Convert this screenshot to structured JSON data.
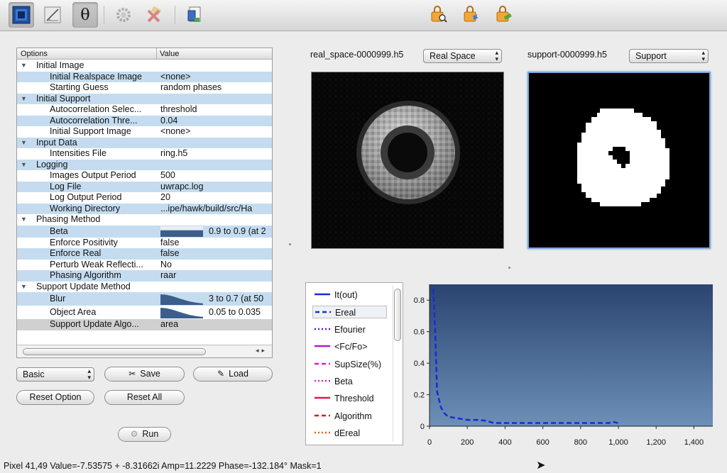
{
  "toolbar": {
    "buttons": [
      {
        "icon": "image-view-icon"
      },
      {
        "icon": "options-edit-icon"
      },
      {
        "icon": "theta-icon",
        "text": "θ"
      },
      {
        "icon": "gear-icon"
      },
      {
        "icon": "tools-disabled-icon"
      },
      {
        "icon": "document-icon"
      },
      {
        "icon": "lock-search-icon"
      },
      {
        "icon": "lock-share-icon"
      },
      {
        "icon": "lock-tools-icon"
      }
    ]
  },
  "options": {
    "col_options": "Options",
    "col_value": "Value",
    "rows": [
      {
        "type": "group",
        "label": "Initial Image"
      },
      {
        "type": "item",
        "label": "Initial Realspace Image",
        "value": "<none>"
      },
      {
        "type": "item",
        "label": "Starting Guess",
        "value": "random phases"
      },
      {
        "type": "group",
        "label": "Initial Support"
      },
      {
        "type": "item",
        "label": "Autocorrelation Selec...",
        "value": "threshold"
      },
      {
        "type": "item",
        "label": "Autocorrelation Thre...",
        "value": "0.04"
      },
      {
        "type": "item",
        "label": "Initial Support Image",
        "value": "<none>"
      },
      {
        "type": "group",
        "label": "Input Data"
      },
      {
        "type": "item",
        "label": "Intensities File",
        "value": "ring.h5"
      },
      {
        "type": "group",
        "label": "Logging"
      },
      {
        "type": "item",
        "label": "Images Output Period",
        "value": "500"
      },
      {
        "type": "item",
        "label": "Log File",
        "value": "uwrapc.log"
      },
      {
        "type": "item",
        "label": "Log Output Period",
        "value": "20"
      },
      {
        "type": "item",
        "label": "Working Directory",
        "value": "...ipe/hawk/build/src/Ha"
      },
      {
        "type": "group",
        "label": "Phasing Method"
      },
      {
        "type": "bar",
        "label": "Beta",
        "value": "0.9 to 0.9 (at 2"
      },
      {
        "type": "item",
        "label": "Enforce Positivity",
        "value": "false"
      },
      {
        "type": "item",
        "label": "Enforce Real",
        "value": "false"
      },
      {
        "type": "item",
        "label": "Perturb Weak Reflecti...",
        "value": "No"
      },
      {
        "type": "item",
        "label": "Phasing Algorithm",
        "value": "raar"
      },
      {
        "type": "group",
        "label": "Support Update Method"
      },
      {
        "type": "bar",
        "label": "Blur",
        "value": "3 to 0.7 (at 50"
      },
      {
        "type": "bar",
        "label": "Object Area",
        "value": "0.05 to 0.035"
      },
      {
        "type": "item",
        "label": "Support Update Algo...",
        "value": "area",
        "selected": true
      }
    ]
  },
  "controls": {
    "mode_select": "Basic",
    "save": "Save",
    "load": "Load",
    "reset_option": "Reset Option",
    "reset_all": "Reset All",
    "run": "Run"
  },
  "views": {
    "left_file": "real_space-0000999.h5",
    "left_select": "Real Space",
    "right_file": "support-0000999.h5",
    "right_select": "Support"
  },
  "legend": [
    {
      "name": "It(out)",
      "color": "#1a2bd6",
      "dash": "solid"
    },
    {
      "name": "Ereal",
      "color": "#1a2bd6",
      "dash": "dash",
      "selected": true
    },
    {
      "name": "Efourier",
      "color": "#5c18c8",
      "dash": "dot"
    },
    {
      "name": "<Fc/Fo>",
      "color": "#b21ad6",
      "dash": "solid"
    },
    {
      "name": "SupSize(%)",
      "color": "#e01ad6",
      "dash": "dash"
    },
    {
      "name": "Beta",
      "color": "#e01ac0",
      "dash": "dot"
    },
    {
      "name": "Threshold",
      "color": "#e0184a",
      "dash": "solid"
    },
    {
      "name": "Algorithm",
      "color": "#e01818",
      "dash": "dash"
    },
    {
      "name": "dEreal",
      "color": "#e0601a",
      "dash": "dot"
    }
  ],
  "chart_data": {
    "type": "line",
    "xlim": [
      0,
      1500
    ],
    "ylim": [
      0,
      0.9
    ],
    "x_ticks": [
      "0",
      "200",
      "400",
      "600",
      "800",
      "1,000",
      "1,200",
      "1,400"
    ],
    "y_ticks": [
      "0",
      "0.2",
      "0.4",
      "0.6",
      "0.8"
    ],
    "series": [
      {
        "name": "Ereal",
        "color": "#1a2bd6",
        "x": [
          20,
          30,
          40,
          50,
          60,
          80,
          100,
          150,
          200,
          250,
          300,
          340,
          400,
          500,
          600,
          700,
          800,
          900,
          950,
          970,
          1000
        ],
        "y": [
          0.87,
          0.6,
          0.22,
          0.17,
          0.12,
          0.08,
          0.06,
          0.05,
          0.04,
          0.04,
          0.035,
          0.02,
          0.02,
          0.02,
          0.02,
          0.02,
          0.02,
          0.02,
          0.02,
          0.028,
          0.02
        ]
      }
    ]
  },
  "status": "Pixel 41,49 Value=-7.53575 + -8.31662i Amp=11.2229 Phase=-132.184° Mask=1"
}
